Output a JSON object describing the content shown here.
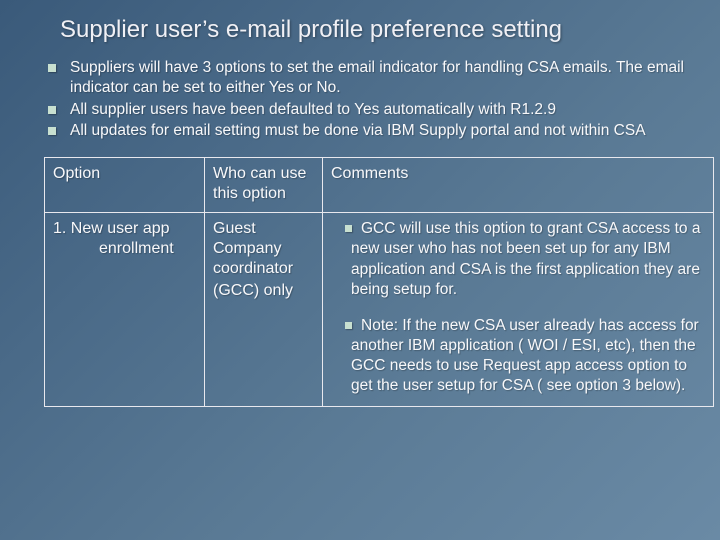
{
  "title": "Supplier user’s e-mail profile preference setting",
  "bullets": [
    "Suppliers will have 3 options to set the email indicator for handling CSA emails. The email indicator can be set to either Yes or No.",
    "All supplier users have been defaulted to Yes automatically with R1.2.9",
    "All updates for email setting must be done via IBM Supply portal and not within CSA"
  ],
  "table": {
    "header": {
      "option": "Option",
      "who": "Who can use this option",
      "comments": "Comments"
    },
    "row1": {
      "option_line1": "1. New user app",
      "option_line2": "enrollment",
      "who_line1": "Guest Company coordinator",
      "who_line2": "(GCC) only",
      "comment1": "GCC will use this option to grant CSA access to a new user who has not been set up for any IBM application and CSA is the first application they are being setup for.",
      "comment2": "Note: If the new CSA user already has access for another IBM application ( WOI / ESI, etc), then the GCC needs to use Request app access option to get the user setup for CSA ( see option 3 below)."
    }
  }
}
